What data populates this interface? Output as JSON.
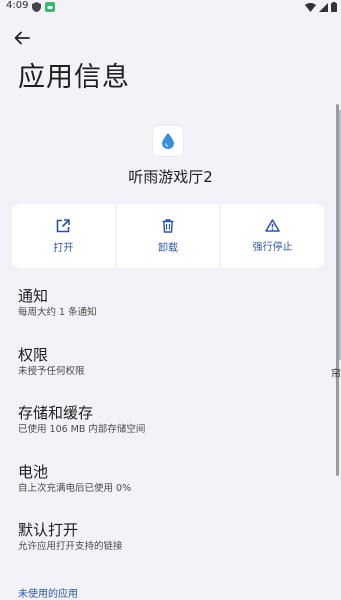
{
  "status_bar": {
    "time": "4:09",
    "left_icons": [
      "shield-icon",
      "android-icon"
    ],
    "right_icons": [
      "wifi-icon",
      "signal-icon",
      "battery-icon"
    ]
  },
  "header": {
    "back_icon": "arrow-back-icon",
    "title": "应用信息"
  },
  "app": {
    "icon": "water-drop-icon",
    "name": "听雨游戏厅2"
  },
  "actions": [
    {
      "label": "打开",
      "icon": "open-in-new-icon"
    },
    {
      "label": "卸载",
      "icon": "trash-icon"
    },
    {
      "label": "强行停止",
      "icon": "warning-icon"
    }
  ],
  "settings": [
    {
      "title": "通知",
      "summary": "每周大约 1 条通知"
    },
    {
      "title": "权限",
      "summary": "未授予任何权限"
    },
    {
      "title": "存储和缓存",
      "summary": "已使用 106 MB 内部存储空间"
    },
    {
      "title": "电池",
      "summary": "自上次充满电后已使用 0%"
    },
    {
      "title": "默认打开",
      "summary": "允许应用打开支持的链接"
    }
  ],
  "section_header": "未使用的应用",
  "right_edge_fragment": "帘",
  "colors": {
    "background": "#f3f2f8",
    "accent": "#2a56a8",
    "card": "#ffffff"
  }
}
